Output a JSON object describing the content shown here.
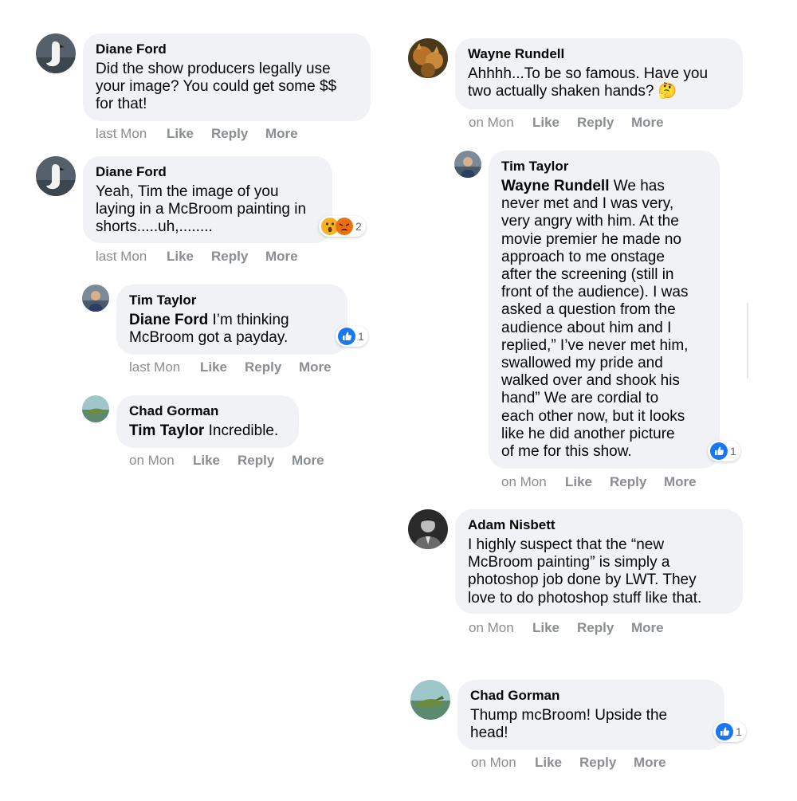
{
  "comments": [
    {
      "name": "Diane Ford",
      "text": "Did the show producers legally use your image? You could get some $$ for that!",
      "lines": [
        "Did the show producers legally use",
        "your image? You could get some $$",
        "for that!"
      ],
      "time": "last Mon",
      "like": "Like",
      "reply": "Reply",
      "more": "More"
    },
    {
      "name": "Diane Ford",
      "lines": [
        "Yeah, Tim the image of you",
        "laying in a McBroom painting in",
        "shorts.....uh,........"
      ],
      "time": "last Mon",
      "like": "Like",
      "reply": "Reply",
      "more": "More",
      "reaction_count": "2"
    },
    {
      "name": "Tim Taylor",
      "mention": "Diane Ford",
      "line1_rest": " I’m thinking",
      "line2": "McBroom got a payday.",
      "time": "last Mon",
      "like": "Like",
      "reply": "Reply",
      "more": "More",
      "reaction_count": "1"
    },
    {
      "name": "Chad Gorman",
      "mention": "Tim Taylor",
      "line1_rest": " Incredible.",
      "time": "on Mon",
      "like": "Like",
      "reply": "Reply",
      "more": "More"
    },
    {
      "name": "Wayne Rundell",
      "lines": [
        "Ahhhh...To be so famous. Have you",
        "two actually shaken hands?"
      ],
      "emoji": "🤔",
      "time": "on Mon",
      "like": "Like",
      "reply": "Reply",
      "more": "More"
    },
    {
      "name": "Tim Taylor",
      "mention": "Wayne Rundell",
      "line1_rest": " We has",
      "lines": [
        "never met and I was very,",
        "very angry with him. At the",
        "movie premier he made no",
        "approach to me onstage",
        "after the screening (still in",
        "front of the audience). I was",
        "asked a question from the",
        "audience about him and I",
        "replied,” I’ve never met him,",
        "swallowed my pride and",
        "walked over and shook his",
        "hand” We are cordial to",
        "each other now, but it looks",
        "like he did another picture",
        "of me for this show."
      ],
      "time": "on Mon",
      "like": "Like",
      "reply": "Reply",
      "more": "More",
      "reaction_count": "1"
    },
    {
      "name": "Adam Nisbett",
      "lines": [
        "I highly suspect that the “new",
        "McBroom painting” is simply a",
        "photoshop job done by LWT. They",
        "love to do photoshop stuff like that."
      ],
      "time": "on Mon",
      "like": "Like",
      "reply": "Reply",
      "more": "More"
    },
    {
      "name": "Chad Gorman",
      "lines": [
        "Thump mcBroom! Upside the",
        "head!"
      ],
      "time": "on Mon",
      "like": "Like",
      "reply": "Reply",
      "more": "More",
      "reaction_count": "1"
    }
  ],
  "colors": {
    "bubble": "#f0f2f5",
    "like_blue": "#1877f2",
    "angry_orange": "#e9710f",
    "wow_yellow": "#f7b125",
    "meta_gray": "#8a8d91"
  }
}
